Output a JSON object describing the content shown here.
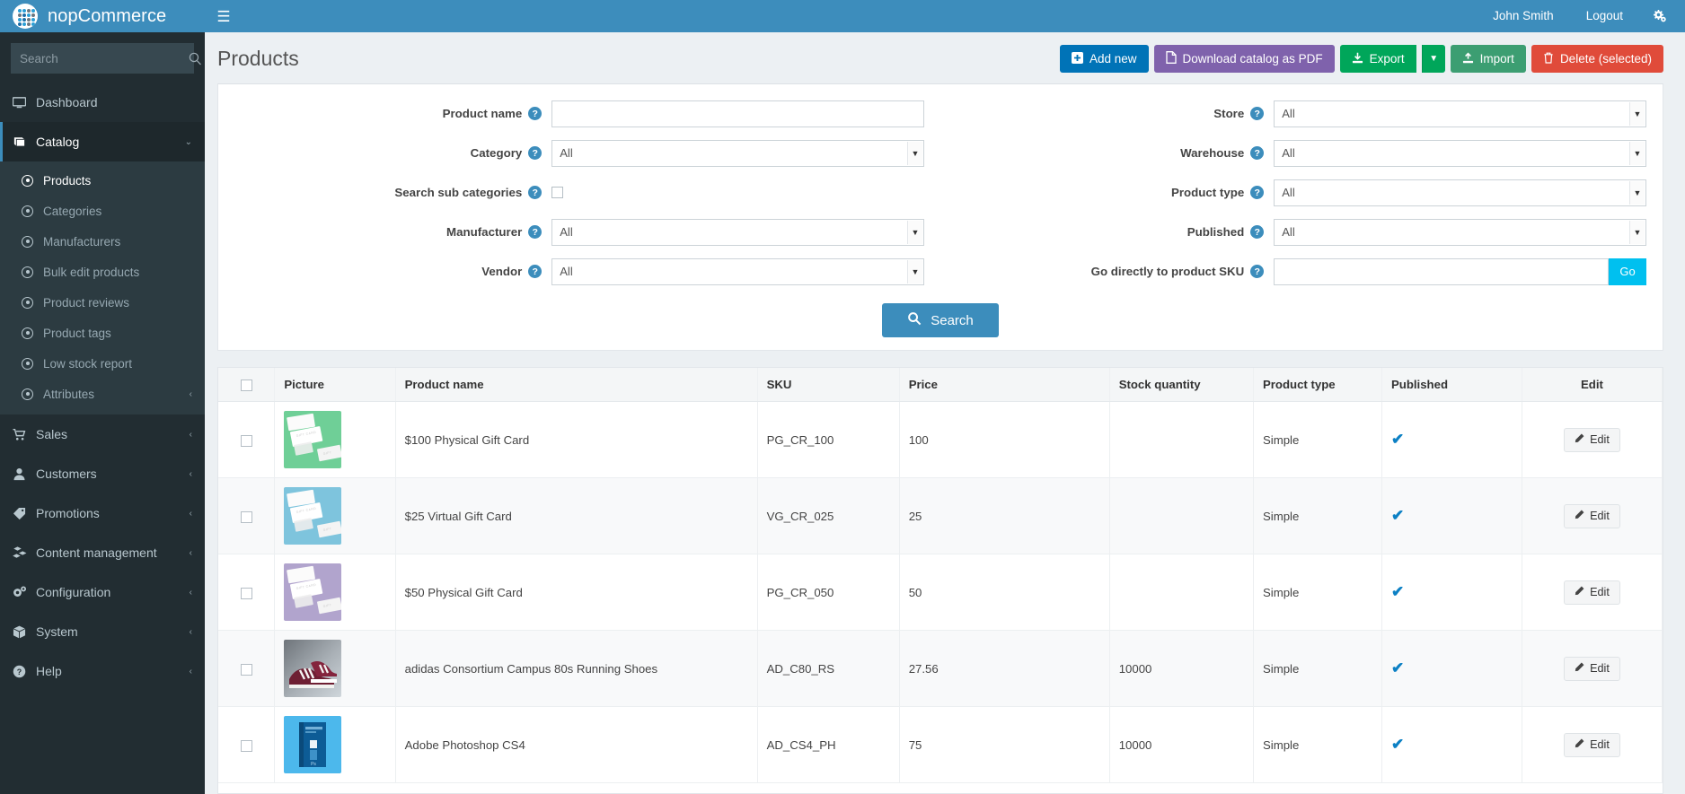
{
  "topbar": {
    "brand": "nopCommerce",
    "menu_toggle": "☰",
    "user": "John Smith",
    "logout": "Logout"
  },
  "sidebar": {
    "search_placeholder": "Search",
    "items": [
      {
        "label": "Dashboard",
        "icon": "monitor-icon",
        "caret": ""
      },
      {
        "label": "Catalog",
        "icon": "book-icon",
        "caret": "⌄"
      },
      {
        "label": "Sales",
        "icon": "cart-icon",
        "caret": "‹"
      },
      {
        "label": "Customers",
        "icon": "user-icon",
        "caret": "‹"
      },
      {
        "label": "Promotions",
        "icon": "tag-icon",
        "caret": "‹"
      },
      {
        "label": "Content management",
        "icon": "blocks-icon",
        "caret": "‹"
      },
      {
        "label": "Configuration",
        "icon": "gears-icon",
        "caret": "‹"
      },
      {
        "label": "System",
        "icon": "cube-icon",
        "caret": "‹"
      },
      {
        "label": "Help",
        "icon": "question-icon",
        "caret": "‹"
      }
    ],
    "catalog_sub": [
      {
        "label": "Products",
        "caret": ""
      },
      {
        "label": "Categories",
        "caret": ""
      },
      {
        "label": "Manufacturers",
        "caret": ""
      },
      {
        "label": "Bulk edit products",
        "caret": ""
      },
      {
        "label": "Product reviews",
        "caret": ""
      },
      {
        "label": "Product tags",
        "caret": ""
      },
      {
        "label": "Low stock report",
        "caret": ""
      },
      {
        "label": "Attributes",
        "caret": "‹"
      }
    ]
  },
  "page": {
    "title": "Products"
  },
  "toolbar": {
    "add_new": "Add new",
    "download_pdf": "Download catalog as PDF",
    "export": "Export",
    "import": "Import",
    "delete_selected": "Delete (selected)"
  },
  "filters": {
    "product_name": {
      "label": "Product name",
      "value": "",
      "placeholder": ""
    },
    "category": {
      "label": "Category",
      "value": "All"
    },
    "search_sub_categories": {
      "label": "Search sub categories",
      "checked": false
    },
    "manufacturer": {
      "label": "Manufacturer",
      "value": "All"
    },
    "vendor": {
      "label": "Vendor",
      "value": "All"
    },
    "store": {
      "label": "Store",
      "value": "All"
    },
    "warehouse": {
      "label": "Warehouse",
      "value": "All"
    },
    "product_type": {
      "label": "Product type",
      "value": "All"
    },
    "published": {
      "label": "Published",
      "value": "All"
    },
    "go_to_sku": {
      "label": "Go directly to product SKU",
      "value": "",
      "button": "Go"
    },
    "search_button": "Search",
    "help_glyph": "?"
  },
  "table": {
    "columns": [
      "",
      "Picture",
      "Product name",
      "SKU",
      "Price",
      "Stock quantity",
      "Product type",
      "Published",
      "Edit"
    ],
    "edit_label": "Edit",
    "published_glyph": "✔",
    "rows": [
      {
        "name": "$100 Physical Gift Card",
        "sku": "PG_CR_100",
        "price": "100",
        "stock": "",
        "type": "Simple",
        "published": true,
        "thumb": "giftcard-green-thumb",
        "thumb_bg": "#6fcf97"
      },
      {
        "name": "$25 Virtual Gift Card",
        "sku": "VG_CR_025",
        "price": "25",
        "stock": "",
        "type": "Simple",
        "published": true,
        "thumb": "giftcard-blue-thumb",
        "thumb_bg": "#7ec4dd"
      },
      {
        "name": "$50 Physical Gift Card",
        "sku": "PG_CR_050",
        "price": "50",
        "stock": "",
        "type": "Simple",
        "published": true,
        "thumb": "giftcard-purple-thumb",
        "thumb_bg": "#b1a4cd"
      },
      {
        "name": "adidas Consortium Campus 80s Running Shoes",
        "sku": "AD_C80_RS",
        "price": "27.56",
        "stock": "10000",
        "type": "Simple",
        "published": true,
        "thumb": "adidas-shoes-thumb",
        "thumb_bg": "#8f969c"
      },
      {
        "name": "Adobe Photoshop CS4",
        "sku": "AD_CS4_PH",
        "price": "75",
        "stock": "10000",
        "type": "Simple",
        "published": true,
        "thumb": "photoshop-box-thumb",
        "thumb_bg": "#43b3e8"
      }
    ]
  },
  "colors": {
    "brand_blue": "#3d8dbc",
    "sidebar_dark": "#222d32",
    "accent_cyan": "#00c0ef",
    "success_green": "#00a65a",
    "danger_red": "#e04b3a",
    "purple": "#7f62ac",
    "published_check": "#0c80c4"
  }
}
